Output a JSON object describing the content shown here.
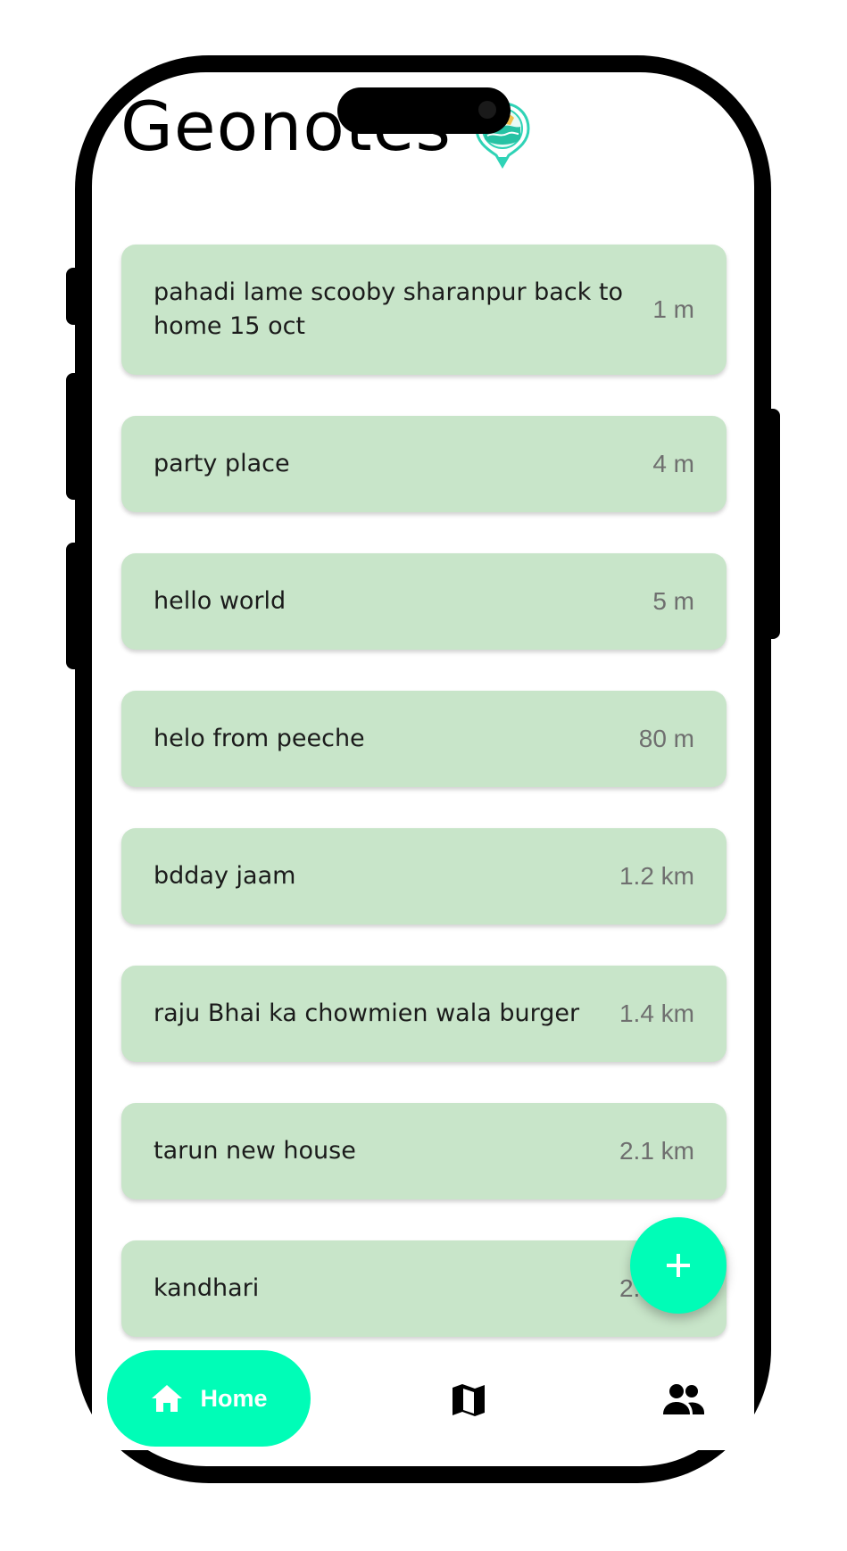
{
  "app": {
    "title": "Geonotes",
    "logo_icon": "map-pin-logo-icon"
  },
  "colors": {
    "card_background": "#c8e5c9",
    "accent": "#00fdb7",
    "distance_text": "#6f6f6f"
  },
  "notes": [
    {
      "title": "pahadi lame scooby sharanpur back to home 15 oct",
      "distance": "1 m"
    },
    {
      "title": "party place",
      "distance": "4 m"
    },
    {
      "title": "hello world",
      "distance": "5 m"
    },
    {
      "title": "helo from peeche",
      "distance": "80 m"
    },
    {
      "title": "bdday jaam",
      "distance": "1.2 km"
    },
    {
      "title": "raju Bhai ka chowmien wala burger",
      "distance": "1.4 km"
    },
    {
      "title": "tarun new house",
      "distance": "2.1 km"
    },
    {
      "title": "kandhari",
      "distance": "2.2 km"
    }
  ],
  "fab": {
    "icon": "plus-icon"
  },
  "bottom_nav": {
    "home_label": "Home",
    "home_icon": "home-icon",
    "map_icon": "map-icon",
    "people_icon": "people-icon"
  }
}
